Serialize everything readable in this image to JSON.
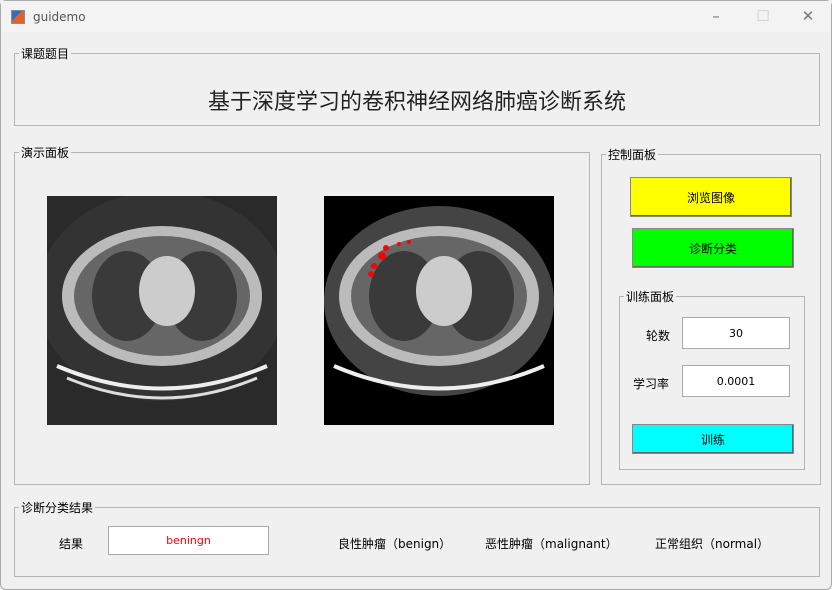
{
  "window": {
    "title": "guidemo",
    "minimize": "–",
    "maximize": "☐",
    "close": "✕"
  },
  "title_panel": {
    "label": "课题题目",
    "text": "基于深度学习的卷积神经网络肺癌诊断系统"
  },
  "demo_panel": {
    "label": "演示面板"
  },
  "control_panel": {
    "label": "控制面板",
    "browse": "浏览图像",
    "classify": "诊断分类",
    "colors": {
      "browse": "#ffff00",
      "classify": "#00ff00",
      "train": "#00ffff"
    }
  },
  "train_panel": {
    "label": "训练面板",
    "epochs_label": "轮数",
    "epochs": "30",
    "lr_label": "学习率",
    "lr": "0.0001",
    "train": "训练"
  },
  "result_panel": {
    "label": "诊断分类结果",
    "result_label": "结果",
    "result": "beningn",
    "classes": [
      "良性肿瘤（benign）",
      "恶性肿瘤（malignant）",
      "正常组织（normal）"
    ]
  }
}
